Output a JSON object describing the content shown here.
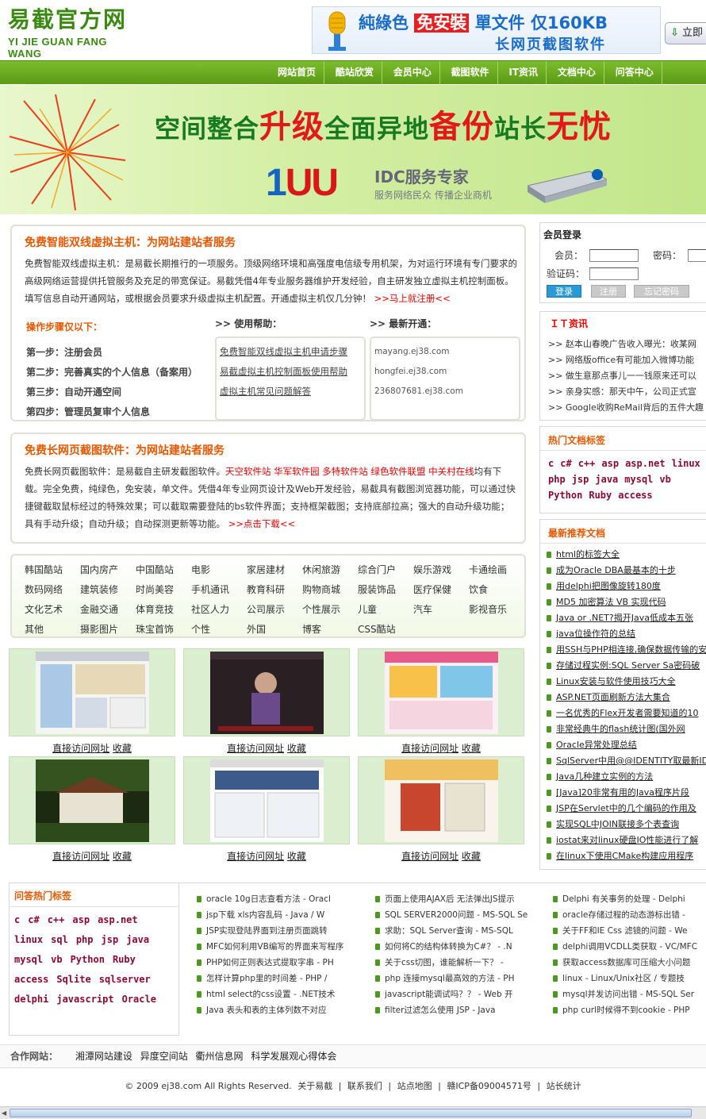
{
  "header": {
    "logo_cn": "易截官方网",
    "logo_en": "YI JIE GUAN FANG WANG",
    "ad_line1_a": "純綠色",
    "ad_line1_b": "免安裝",
    "ad_line1_c": "單文件",
    "ad_line1_d": "仅160KB",
    "ad_line2": "长网页截图软件",
    "download_button": "立即"
  },
  "nav": {
    "items": [
      "网站首页",
      "酷站欣赏",
      "会员中心",
      "截图软件",
      "IT资讯",
      "文档中心",
      "问答中心"
    ]
  },
  "hero": {
    "slogan_1": "空间整合",
    "slogan_2": "升级",
    "slogan_3": "全面异地",
    "slogan_4": "备份",
    "slogan_5": "站长",
    "slogan_6": "无忧",
    "brand_1": "1",
    "brand_2": "UU",
    "idc": "IDC服务专家",
    "idc_sub": "服务网络民众  传播企业商机"
  },
  "vhost": {
    "title": "免费智能双线虚拟主机：为网站建站者服务",
    "text": "免费智能双线虚拟主机：是易截长期推行的一项服务。顶级网络环境和高强度电信级专用机架，为对运行环境有专门要求的高级网络运营提供托管服务及充足的带宽保证。易截凭借4年专业服务器维护开发经验，自主研发独立虚拟主机控制面板。填写信息自动开通网站，或根据会员要求升级虚拟主机配置。开通虚拟主机仅几分钟！",
    "register_link": ">>马上就注册<<",
    "steps_title": "操作步骤仅以下：",
    "steps": [
      "第一步：注册会员",
      "第二步：完善真实的个人信息（备案用）",
      "第三步：自动开通空间",
      "第四步：管理员复审个人信息"
    ],
    "help_title": ">> 使用帮助：",
    "help_links": [
      "免费智能双线虚拟主机申请步骤",
      "易截虚拟主机控制面板使用帮助",
      "虚拟主机常见问题解答"
    ],
    "new_title": ">> 最新开通：",
    "new_sites": [
      "mayang.ej38.com",
      "hongfei.ej38.com",
      "236807681.ej38.com"
    ]
  },
  "software": {
    "title": "免费长网页截图软件：为网站建站者服务",
    "text_a": "免费长网页截图软件：是易截自主研发截图软件。",
    "partners_red": "天空软件站  华军软件园  多特软件站  绿色软件联盟  中关村在线",
    "text_b": "均有下载。完全免费，纯绿色，免安装，单文件。凭借4年专业网页设计及Web开发经验，易截具有截图浏览器功能，可以通过快捷键截取鼠标经过的特殊效果；可以截取需要登陆的bs软件界面；支持框架截图；支持底部拉高；强大的自动升级功能；具有手动升级；自动升级；自动探测更新等功能。",
    "download_link": ">>点击下载<<"
  },
  "categories": [
    "韩国酷站",
    "国内房产",
    "中国酷站",
    "电影",
    "家居建材",
    "休闲旅游",
    "综合门户",
    "娱乐游戏",
    "卡通绘画",
    "数码网络",
    "建筑装修",
    "时尚美容",
    "手机通讯",
    "教育科研",
    "购物商城",
    "服装饰品",
    "医疗保健",
    "饮食",
    "文化艺术",
    "金融交通",
    "体育竞技",
    "社区人力",
    "公司展示",
    "个性展示",
    "儿童",
    "汽车",
    "影视音乐",
    "其他",
    "摄影图片",
    "珠宝首饰",
    "个性",
    "外国",
    "博客",
    "CSS酷站"
  ],
  "thumbs": {
    "visit": "直接访问网址",
    "fav": "收藏"
  },
  "qa": {
    "title": "问答热门标签",
    "tags": [
      "c",
      "c#",
      "c++",
      "asp",
      "asp.net",
      "linux",
      "sql",
      "php",
      "jsp",
      "java",
      "mysql",
      "vb",
      "Python",
      "Ruby",
      "access",
      "Sqlite",
      "sqlserver",
      "delphi",
      "javascript",
      "Oracle"
    ],
    "col1": [
      "oracle 10g日志查看方法 - Oracl",
      "jsp下载 xls内容乱码 - Java / W",
      "JSP实现登陆界面到注册页面跳转",
      "MFC如何利用VB编写的界面来写程序",
      "PHP如何正则表达式提取字串 - PH",
      "怎样计算php里的时间差 - PHP /",
      "html select的css设置 - .NET技术",
      "Java 表头和表的主体列数不对应"
    ],
    "col2": [
      "页面上使用AJAX后 无法弹出JS提示",
      "SQL SERVER2000问题 - MS-SQL Se",
      "求助：SQL Server查询 - MS-SQL",
      "如何将C的结构体转换为C#？ - .N",
      "关于css切图，谁能解析一下？ -",
      "php 连接mysql最高效的方法 - PH",
      "javascript能调试吗？？ - Web 开",
      "filter过滤怎么使用 JSP - Java"
    ],
    "col3": [
      "Delphi 有关事务的处理 - Delphi",
      "oracle存储过程的动态游标出错 -",
      "关于FF和IE Css 滤镜的问题 - We",
      "delphi调用VCDLL类获取 - VC/MFC",
      "获取access数据库可压缩大小问题",
      "linux - Linux/Unix社区 / 专题技",
      "mysql并发访问出错 - MS-SQL Ser",
      "php curl时候得不到cookie - PHP"
    ]
  },
  "login": {
    "title": "会员登录",
    "user_label": "会员：",
    "pass_label": "密码：",
    "code_label": "验证码：",
    "login_btn": "登录",
    "reg_btn": "注册",
    "forgot_btn": "忘记密码"
  },
  "it_news": {
    "title": "ＩＴ资讯",
    "items": [
      ">>  赵本山春晚广告收入曝光：收某网",
      ">>  网络版office有可能加入微博功能",
      ">>  做生意那点事儿一一钱原来还可以",
      ">>  亲身实感：那天中午，公司正式宣",
      ">>  Google收购ReMail背后的五件大趣"
    ]
  },
  "hot_tags": {
    "title": "热门文档标签",
    "tags": [
      "c",
      "c#",
      "c++",
      "asp",
      "asp.net",
      "linux",
      "php",
      "jsp",
      "java",
      "mysql",
      "vb",
      "Python",
      "Ruby",
      "access"
    ]
  },
  "rec_docs": {
    "title": "最新推荐文档",
    "items": [
      "html的标签大全",
      "成为Oracle DBA最基本的十步",
      "用delphi把图像旋转180度",
      "MD5 加密算法 VB 实现代码",
      "Java or .NET?揭开Java低成本五张",
      "java位操作符的总结",
      "用SSH与PHP相连接,确保数据传输的安",
      "存储过程实例:SQL Server Sa密码破",
      "Linux安装与软件使用技巧大全",
      "ASP.NET页面刷新方法大集合",
      "一名优秀的Flex开发者需要知道的10",
      "非常经典牛的flash统计图(国外网",
      "Oracle异常处理总结",
      "SqlServer中用@@IDENTITY取最新ID",
      "Java几种建立实例的方法",
      "[Java]20非常有用的Java程序片段",
      "JSP在Servlet中的几个编码的作用及",
      "实现SQL中JOIN联接多个表查询",
      "iostat来对linux硬盘IO性能进行了解",
      "在linux下使用CMake构建应用程序"
    ]
  },
  "footer": {
    "partners_label": "合作网站：",
    "partners": [
      "湘潭网站建设",
      "异度空间站",
      "衢州信息网",
      "科学发展观心得体会"
    ],
    "copyright": "© 2009 ej38.com All Rights Reserved.",
    "links": [
      "关于易截",
      "|",
      "联系我们",
      "|",
      "站点地图",
      "|",
      "赣ICP备09004571号",
      "|",
      "站长统计"
    ]
  },
  "colors": {
    "nav_green": "#6aab22",
    "accent_orange": "#e85800",
    "tag_maroon": "#8b0a32"
  }
}
